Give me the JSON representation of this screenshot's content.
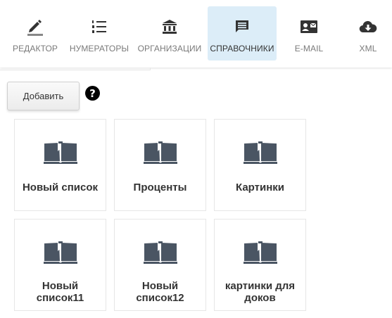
{
  "toolbar": {
    "tabs": [
      {
        "label": "РЕДАКТОР",
        "icon": "pencil-icon",
        "active": false
      },
      {
        "label": "НУМЕРАТОРЫ",
        "icon": "numbered-list-icon",
        "active": false
      },
      {
        "label": "ОРГАНИЗАЦИИ",
        "icon": "institution-icon",
        "active": false
      },
      {
        "label": "СПРАВОЧНИКИ",
        "icon": "message-icon",
        "active": true
      },
      {
        "label": "E-MAIL",
        "icon": "contact-card-icon",
        "active": false
      },
      {
        "label": "XML",
        "icon": "cloud-download-icon",
        "active": false
      }
    ]
  },
  "actions": {
    "add_label": "Добавить",
    "help_label": "?"
  },
  "cards": [
    {
      "label": "Новый список",
      "icon": "book-icon"
    },
    {
      "label": "Проценты",
      "icon": "book-icon"
    },
    {
      "label": "Картинки",
      "icon": "book-icon"
    },
    {
      "label": "Новый список11",
      "icon": "book-icon"
    },
    {
      "label": "Новый список12",
      "icon": "book-icon"
    },
    {
      "label": "картинки для доков",
      "icon": "book-icon"
    }
  ],
  "colors": {
    "active_tab": "#dcedf8",
    "icon": "#333333",
    "book": "#4a5563"
  }
}
